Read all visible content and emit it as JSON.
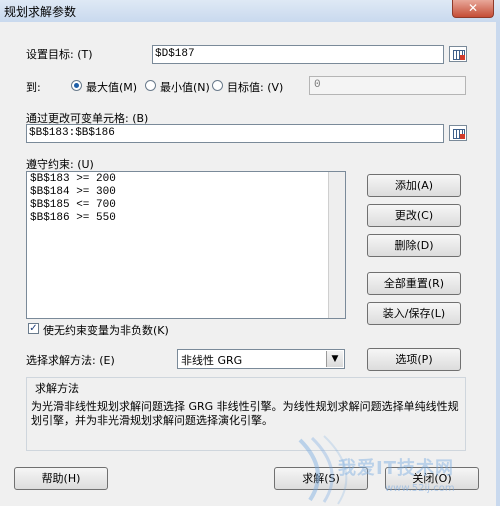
{
  "window": {
    "title": "规划求解参数",
    "close_glyph": "✕"
  },
  "objective": {
    "label": "设置目标: (T)",
    "value": "$D$187"
  },
  "to": {
    "label": "到:",
    "options": [
      "最大值(M)",
      "最小值(N)",
      "目标值: (V)"
    ],
    "selected": "最大值(M)",
    "target_value": "0"
  },
  "variables": {
    "label": "通过更改可变单元格: (B)",
    "value": "$B$183:$B$186"
  },
  "constraints": {
    "label": "遵守约束: (U)",
    "items": [
      "$B$183 >= 200",
      "$B$184 >= 300",
      "$B$185 <= 700",
      "$B$186 >= 550"
    ]
  },
  "side_buttons": {
    "add": "添加(A)",
    "change": "更改(C)",
    "delete": "删除(D)",
    "reset_all": "全部重置(R)",
    "load_save": "装入/保存(L)"
  },
  "nonneg": {
    "label": "使无约束变量为非负数(K)",
    "checked": true
  },
  "method": {
    "label": "选择求解方法: (E)",
    "value": "非线性 GRG",
    "options_button": "选项(P)"
  },
  "solving_method": {
    "title": "求解方法",
    "text": "为光滑非线性规划求解问题选择 GRG 非线性引擎。为线性规划求解问题选择单纯线性规划引擎，并为非光滑规划求解问题选择演化引擎。"
  },
  "footer": {
    "help": "帮助(H)",
    "solve": "求解(S)",
    "close": "关闭(O)"
  },
  "watermark": {
    "text": "我爱IT技术网",
    "url": "www.52ij.com"
  }
}
